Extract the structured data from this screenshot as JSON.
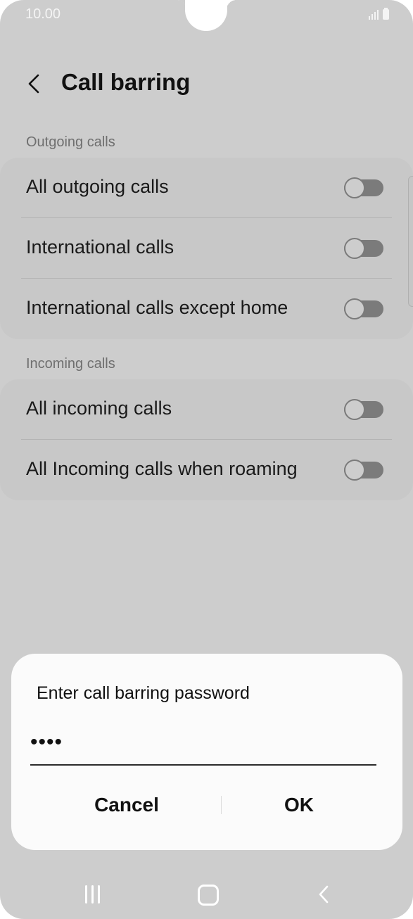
{
  "status_bar": {
    "time": "10.00",
    "signal_icon": "signal-icon",
    "battery_icon": "battery-icon"
  },
  "header": {
    "back_icon": "back-arrow-icon",
    "title": "Call barring"
  },
  "sections": [
    {
      "label": "Outgoing calls",
      "items": [
        {
          "label": "All outgoing calls",
          "enabled": false
        },
        {
          "label": "International calls",
          "enabled": false
        },
        {
          "label": "International calls except home",
          "enabled": false
        }
      ]
    },
    {
      "label": "Incoming calls",
      "items": [
        {
          "label": "All incoming calls",
          "enabled": false
        },
        {
          "label": "All Incoming calls when roaming",
          "enabled": false
        }
      ]
    }
  ],
  "dialog": {
    "title": "Enter call barring password",
    "password_value": "••••",
    "cancel_label": "Cancel",
    "ok_label": "OK"
  },
  "nav_bar": {
    "recents_icon": "recents-icon",
    "home_icon": "home-icon",
    "back_icon": "nav-back-icon"
  },
  "colors": {
    "dim_background": "#cdcdcd",
    "card_background": "#c8c8c8",
    "dialog_background": "#fbfbfb",
    "toggle_off": "#7b7b7b"
  }
}
